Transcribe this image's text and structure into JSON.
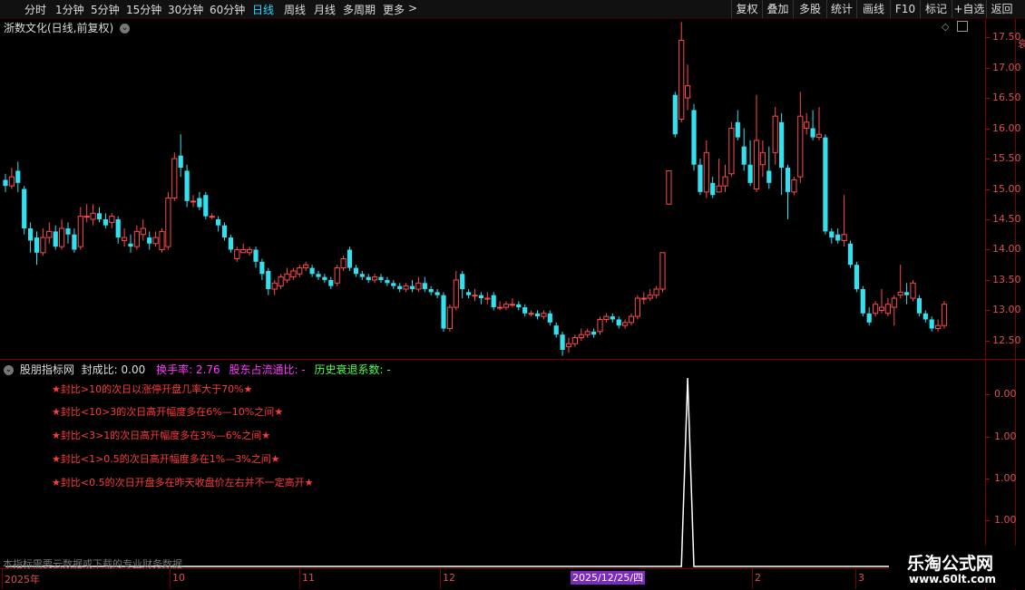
{
  "toolbar": {
    "periods": [
      "分时",
      "1分钟",
      "5分钟",
      "15分钟",
      "30分钟",
      "60分钟",
      "日线",
      "周线",
      "月线",
      "多周期",
      "更多"
    ],
    "active_period": "日线",
    "more_chevron": ">",
    "buttons": [
      "复权",
      "叠加",
      "多股",
      "统计",
      "画线",
      "F10",
      "标记",
      "+自选",
      "返回"
    ]
  },
  "stock": {
    "title": "浙数文化(日线,前复权)"
  },
  "price_axis": {
    "labels": [
      "17.50",
      "17.00",
      "16.50",
      "16.00",
      "15.50",
      "15.00",
      "14.50",
      "14.00",
      "13.50",
      "13.00",
      "12.50"
    ]
  },
  "indicator": {
    "name": "股朋指标网",
    "seal_ratio": "封成比: 0.00",
    "turnover": "换手率: 2.76",
    "shareholder": "股东占流通比: -",
    "decline": "历史衰退系数: -",
    "notes": [
      "★封比>10的次日以涨停开盘几率大于70%★",
      "★封比<10>3的次日高开幅度多在6%—10%之间★",
      "★封比<3>1的次日高开幅度多在3%—6%之间★",
      "★封比<1>0.5的次日高开幅度多在1%—3%之间★",
      "★封比<0.5的次日开盘多在昨天收盘价左右并不一定高开★"
    ],
    "axis_labels": [
      "0.00",
      "1.00",
      "1.00",
      "1.00",
      "1.00"
    ],
    "footnote": "本指标需要云数据或下载的专业财务数据"
  },
  "date_axis": {
    "labels": [
      "2025年",
      "10",
      "11",
      "12",
      "2",
      "3"
    ],
    "highlight": "2025/12/25/四"
  },
  "watermark": {
    "line1": "乐淘公式网",
    "line2": "www.60lt.com"
  },
  "colors": {
    "up": "#ff4a4a",
    "down": "#33e0f0",
    "active": "#2bd7ff",
    "axis": "#7a0000"
  },
  "chart_data": {
    "type": "candlestick",
    "ylim": [
      12.2,
      17.8
    ],
    "candles": [
      {
        "o": 15.15,
        "c": 15.05,
        "h": 15.25,
        "l": 14.95
      },
      {
        "o": 15.05,
        "c": 15.2,
        "h": 15.35,
        "l": 15.0
      },
      {
        "o": 15.3,
        "c": 15.1,
        "h": 15.45,
        "l": 14.95
      },
      {
        "o": 15.0,
        "c": 14.35,
        "h": 15.05,
        "l": 14.25
      },
      {
        "o": 14.35,
        "c": 14.15,
        "h": 14.45,
        "l": 13.95
      },
      {
        "o": 14.2,
        "c": 13.95,
        "h": 14.3,
        "l": 13.75
      },
      {
        "o": 13.95,
        "c": 14.2,
        "h": 14.35,
        "l": 13.9
      },
      {
        "o": 14.2,
        "c": 14.3,
        "h": 14.45,
        "l": 14.1
      },
      {
        "o": 14.3,
        "c": 14.05,
        "h": 14.4,
        "l": 14.0
      },
      {
        "o": 14.05,
        "c": 14.35,
        "h": 14.5,
        "l": 14.0
      },
      {
        "o": 14.35,
        "c": 14.25,
        "h": 14.45,
        "l": 14.1
      },
      {
        "o": 14.25,
        "c": 14.0,
        "h": 14.35,
        "l": 13.95
      },
      {
        "o": 14.05,
        "c": 14.55,
        "h": 14.7,
        "l": 14.0
      },
      {
        "o": 14.55,
        "c": 14.55,
        "h": 14.75,
        "l": 14.45
      },
      {
        "o": 14.5,
        "c": 14.6,
        "h": 14.75,
        "l": 14.4
      },
      {
        "o": 14.6,
        "c": 14.5,
        "h": 14.7,
        "l": 14.45
      },
      {
        "o": 14.5,
        "c": 14.4,
        "h": 14.6,
        "l": 14.35
      },
      {
        "o": 14.45,
        "c": 14.55,
        "h": 14.6,
        "l": 14.35
      },
      {
        "o": 14.5,
        "c": 14.2,
        "h": 14.55,
        "l": 14.1
      },
      {
        "o": 14.15,
        "c": 14.2,
        "h": 14.35,
        "l": 14.05
      },
      {
        "o": 14.1,
        "c": 14.05,
        "h": 14.25,
        "l": 13.95
      },
      {
        "o": 14.05,
        "c": 14.3,
        "h": 14.4,
        "l": 14.0
      },
      {
        "o": 14.25,
        "c": 14.35,
        "h": 14.5,
        "l": 14.15
      },
      {
        "o": 14.2,
        "c": 14.1,
        "h": 14.3,
        "l": 14.0
      },
      {
        "o": 14.1,
        "c": 14.2,
        "h": 14.3,
        "l": 14.05
      },
      {
        "o": 14.0,
        "c": 14.3,
        "h": 14.35,
        "l": 13.95
      },
      {
        "o": 14.05,
        "c": 14.85,
        "h": 14.95,
        "l": 14.0
      },
      {
        "o": 14.85,
        "c": 15.5,
        "h": 15.6,
        "l": 14.8
      },
      {
        "o": 15.55,
        "c": 15.35,
        "h": 15.9,
        "l": 15.2
      },
      {
        "o": 15.3,
        "c": 14.8,
        "h": 15.4,
        "l": 14.7
      },
      {
        "o": 14.8,
        "c": 14.8,
        "h": 14.9,
        "l": 14.7
      },
      {
        "o": 14.85,
        "c": 14.7,
        "h": 14.95,
        "l": 14.65
      },
      {
        "o": 14.9,
        "c": 14.55,
        "h": 14.95,
        "l": 14.5
      },
      {
        "o": 14.55,
        "c": 14.55,
        "h": 14.6,
        "l": 14.5
      },
      {
        "o": 14.5,
        "c": 14.4,
        "h": 14.55,
        "l": 14.3
      },
      {
        "o": 14.4,
        "c": 14.2,
        "h": 14.45,
        "l": 14.15
      },
      {
        "o": 14.2,
        "c": 14.0,
        "h": 14.25,
        "l": 13.95
      },
      {
        "o": 13.85,
        "c": 14.0,
        "h": 14.05,
        "l": 13.8
      },
      {
        "o": 13.95,
        "c": 14.0,
        "h": 14.1,
        "l": 13.95
      },
      {
        "o": 13.95,
        "c": 14.0,
        "h": 14.05,
        "l": 13.9
      },
      {
        "o": 14.0,
        "c": 13.8,
        "h": 14.05,
        "l": 13.7
      },
      {
        "o": 13.8,
        "c": 13.6,
        "h": 13.85,
        "l": 13.5
      },
      {
        "o": 13.65,
        "c": 13.35,
        "h": 13.7,
        "l": 13.25
      },
      {
        "o": 13.35,
        "c": 13.45,
        "h": 13.5,
        "l": 13.25
      },
      {
        "o": 13.4,
        "c": 13.55,
        "h": 13.6,
        "l": 13.35
      },
      {
        "o": 13.5,
        "c": 13.6,
        "h": 13.7,
        "l": 13.45
      },
      {
        "o": 13.55,
        "c": 13.65,
        "h": 13.7,
        "l": 13.5
      },
      {
        "o": 13.6,
        "c": 13.7,
        "h": 13.75,
        "l": 13.55
      },
      {
        "o": 13.7,
        "c": 13.75,
        "h": 13.8,
        "l": 13.65
      },
      {
        "o": 13.7,
        "c": 13.6,
        "h": 13.75,
        "l": 13.55
      },
      {
        "o": 13.6,
        "c": 13.55,
        "h": 13.65,
        "l": 13.5
      },
      {
        "o": 13.55,
        "c": 13.5,
        "h": 13.6,
        "l": 13.45
      },
      {
        "o": 13.5,
        "c": 13.4,
        "h": 13.55,
        "l": 13.35
      },
      {
        "o": 13.45,
        "c": 13.7,
        "h": 13.75,
        "l": 13.4
      },
      {
        "o": 13.7,
        "c": 13.85,
        "h": 13.9,
        "l": 13.65
      },
      {
        "o": 14.0,
        "c": 13.7,
        "h": 14.05,
        "l": 13.65
      },
      {
        "o": 13.7,
        "c": 13.6,
        "h": 13.75,
        "l": 13.55
      },
      {
        "o": 13.6,
        "c": 13.55,
        "h": 13.65,
        "l": 13.5
      },
      {
        "o": 13.55,
        "c": 13.5,
        "h": 13.6,
        "l": 13.45
      },
      {
        "o": 13.5,
        "c": 13.55,
        "h": 13.6,
        "l": 13.45
      },
      {
        "o": 13.55,
        "c": 13.5,
        "h": 13.6,
        "l": 13.45
      },
      {
        "o": 13.5,
        "c": 13.45,
        "h": 13.55,
        "l": 13.4
      },
      {
        "o": 13.45,
        "c": 13.4,
        "h": 13.5,
        "l": 13.35
      },
      {
        "o": 13.4,
        "c": 13.35,
        "h": 13.45,
        "l": 13.3
      },
      {
        "o": 13.35,
        "c": 13.4,
        "h": 13.45,
        "l": 13.3
      },
      {
        "o": 13.4,
        "c": 13.35,
        "h": 13.5,
        "l": 13.3
      },
      {
        "o": 13.35,
        "c": 13.45,
        "h": 13.55,
        "l": 13.3
      },
      {
        "o": 13.45,
        "c": 13.35,
        "h": 13.55,
        "l": 13.3
      },
      {
        "o": 13.35,
        "c": 13.3,
        "h": 13.4,
        "l": 13.25
      },
      {
        "o": 13.3,
        "c": 13.25,
        "h": 13.35,
        "l": 13.2
      },
      {
        "o": 13.25,
        "c": 12.7,
        "h": 13.3,
        "l": 12.65
      },
      {
        "o": 12.7,
        "c": 13.05,
        "h": 13.1,
        "l": 12.65
      },
      {
        "o": 13.05,
        "c": 13.5,
        "h": 13.65,
        "l": 13.0
      },
      {
        "o": 13.6,
        "c": 13.35,
        "h": 13.65,
        "l": 13.2
      },
      {
        "o": 13.3,
        "c": 13.25,
        "h": 13.35,
        "l": 13.2
      },
      {
        "o": 13.25,
        "c": 13.25,
        "h": 13.35,
        "l": 13.15
      },
      {
        "o": 13.25,
        "c": 13.2,
        "h": 13.3,
        "l": 13.1
      },
      {
        "o": 13.2,
        "c": 13.2,
        "h": 13.3,
        "l": 13.1
      },
      {
        "o": 13.25,
        "c": 13.05,
        "h": 13.3,
        "l": 13.0
      },
      {
        "o": 13.05,
        "c": 13.05,
        "h": 13.15,
        "l": 13.0
      },
      {
        "o": 13.05,
        "c": 13.1,
        "h": 13.15,
        "l": 13.0
      },
      {
        "o": 13.1,
        "c": 13.1,
        "h": 13.2,
        "l": 13.05
      },
      {
        "o": 13.1,
        "c": 13.05,
        "h": 13.15,
        "l": 13.0
      },
      {
        "o": 13.05,
        "c": 12.95,
        "h": 13.1,
        "l": 12.9
      },
      {
        "o": 12.95,
        "c": 12.95,
        "h": 13.0,
        "l": 12.9
      },
      {
        "o": 12.95,
        "c": 12.9,
        "h": 13.0,
        "l": 12.85
      },
      {
        "o": 12.9,
        "c": 12.95,
        "h": 13.0,
        "l": 12.85
      },
      {
        "o": 12.95,
        "c": 12.8,
        "h": 13.0,
        "l": 12.75
      },
      {
        "o": 12.75,
        "c": 12.6,
        "h": 12.8,
        "l": 12.55
      },
      {
        "o": 12.6,
        "c": 12.35,
        "h": 12.65,
        "l": 12.25
      },
      {
        "o": 12.4,
        "c": 12.45,
        "h": 12.55,
        "l": 12.3
      },
      {
        "o": 12.45,
        "c": 12.55,
        "h": 12.6,
        "l": 12.4
      },
      {
        "o": 12.55,
        "c": 12.6,
        "h": 12.7,
        "l": 12.5
      },
      {
        "o": 12.6,
        "c": 12.65,
        "h": 12.7,
        "l": 12.55
      },
      {
        "o": 12.65,
        "c": 12.6,
        "h": 12.7,
        "l": 12.55
      },
      {
        "o": 12.65,
        "c": 12.85,
        "h": 12.9,
        "l": 12.6
      },
      {
        "o": 12.85,
        "c": 12.9,
        "h": 12.95,
        "l": 12.8
      },
      {
        "o": 12.9,
        "c": 12.85,
        "h": 12.95,
        "l": 12.8
      },
      {
        "o": 12.85,
        "c": 12.75,
        "h": 12.9,
        "l": 12.7
      },
      {
        "o": 12.75,
        "c": 12.8,
        "h": 12.85,
        "l": 12.7
      },
      {
        "o": 12.8,
        "c": 12.9,
        "h": 12.95,
        "l": 12.75
      },
      {
        "o": 12.9,
        "c": 13.2,
        "h": 13.25,
        "l": 12.85
      },
      {
        "o": 13.2,
        "c": 13.2,
        "h": 13.3,
        "l": 13.1
      },
      {
        "o": 13.2,
        "c": 13.25,
        "h": 13.35,
        "l": 13.15
      },
      {
        "o": 13.25,
        "c": 13.35,
        "h": 13.4,
        "l": 13.2
      },
      {
        "o": 13.35,
        "c": 13.95,
        "h": 13.95,
        "l": 13.3
      },
      {
        "o": 14.75,
        "c": 15.3,
        "h": 15.3,
        "l": 14.75
      },
      {
        "o": 16.55,
        "c": 15.9,
        "h": 16.6,
        "l": 15.85
      },
      {
        "o": 16.15,
        "c": 17.45,
        "h": 17.75,
        "l": 16.1
      },
      {
        "o": 16.5,
        "c": 16.7,
        "h": 17.05,
        "l": 16.3
      },
      {
        "o": 16.3,
        "c": 15.4,
        "h": 16.4,
        "l": 15.3
      },
      {
        "o": 15.4,
        "c": 14.95,
        "h": 15.5,
        "l": 14.9
      },
      {
        "o": 14.95,
        "c": 15.6,
        "h": 15.8,
        "l": 14.85
      },
      {
        "o": 15.1,
        "c": 14.9,
        "h": 15.2,
        "l": 14.85
      },
      {
        "o": 14.95,
        "c": 15.05,
        "h": 15.5,
        "l": 14.95
      },
      {
        "o": 15.05,
        "c": 15.2,
        "h": 15.4,
        "l": 14.95
      },
      {
        "o": 15.25,
        "c": 16.0,
        "h": 16.1,
        "l": 15.2
      },
      {
        "o": 16.1,
        "c": 15.85,
        "h": 16.3,
        "l": 15.8
      },
      {
        "o": 15.7,
        "c": 15.4,
        "h": 16.0,
        "l": 15.3
      },
      {
        "o": 15.4,
        "c": 15.1,
        "h": 15.8,
        "l": 15.05
      },
      {
        "o": 15.0,
        "c": 15.8,
        "h": 16.55,
        "l": 14.95
      },
      {
        "o": 15.4,
        "c": 15.6,
        "h": 15.8,
        "l": 15.2
      },
      {
        "o": 15.3,
        "c": 15.1,
        "h": 15.7,
        "l": 15.0
      },
      {
        "o": 15.6,
        "c": 16.2,
        "h": 16.35,
        "l": 15.4
      },
      {
        "o": 16.1,
        "c": 15.35,
        "h": 16.25,
        "l": 14.9
      },
      {
        "o": 15.35,
        "c": 14.95,
        "h": 15.4,
        "l": 14.5
      },
      {
        "o": 14.95,
        "c": 15.15,
        "h": 15.2,
        "l": 14.9
      },
      {
        "o": 15.2,
        "c": 16.2,
        "h": 16.6,
        "l": 15.1
      },
      {
        "o": 16.0,
        "c": 16.1,
        "h": 16.25,
        "l": 15.9
      },
      {
        "o": 16.0,
        "c": 15.85,
        "h": 16.3,
        "l": 15.8
      },
      {
        "o": 15.85,
        "c": 15.9,
        "h": 16.35,
        "l": 15.8
      },
      {
        "o": 15.85,
        "c": 14.3,
        "h": 15.9,
        "l": 14.25
      },
      {
        "o": 14.3,
        "c": 14.2,
        "h": 14.35,
        "l": 14.1
      },
      {
        "o": 14.25,
        "c": 14.15,
        "h": 14.35,
        "l": 14.1
      },
      {
        "o": 14.15,
        "c": 14.25,
        "h": 14.9,
        "l": 14.05
      },
      {
        "o": 14.1,
        "c": 13.75,
        "h": 14.15,
        "l": 13.7
      },
      {
        "o": 13.75,
        "c": 13.35,
        "h": 13.8,
        "l": 13.3
      },
      {
        "o": 13.35,
        "c": 12.95,
        "h": 13.4,
        "l": 12.9
      },
      {
        "o": 12.95,
        "c": 12.8,
        "h": 13.05,
        "l": 12.75
      },
      {
        "o": 12.95,
        "c": 13.1,
        "h": 13.15,
        "l": 12.9
      },
      {
        "o": 13.0,
        "c": 13.05,
        "h": 13.35,
        "l": 12.95
      },
      {
        "o": 12.95,
        "c": 13.1,
        "h": 13.2,
        "l": 12.9
      },
      {
        "o": 13.05,
        "c": 13.2,
        "h": 13.25,
        "l": 12.75
      },
      {
        "o": 13.25,
        "c": 13.3,
        "h": 13.75,
        "l": 13.2
      },
      {
        "o": 13.3,
        "c": 13.25,
        "h": 13.45,
        "l": 13.1
      },
      {
        "o": 13.2,
        "c": 13.45,
        "h": 13.5,
        "l": 13.15
      },
      {
        "o": 13.2,
        "c": 12.95,
        "h": 13.25,
        "l": 12.9
      },
      {
        "o": 12.95,
        "c": 12.85,
        "h": 13.0,
        "l": 12.8
      },
      {
        "o": 12.85,
        "c": 12.7,
        "h": 12.9,
        "l": 12.65
      },
      {
        "o": 12.7,
        "c": 12.75,
        "h": 12.85,
        "l": 12.65
      },
      {
        "o": 12.75,
        "c": 13.1,
        "h": 13.15,
        "l": 12.7
      }
    ],
    "indicator_series": {
      "name": "封成比",
      "spike_index": 109,
      "spike_value": 1.0,
      "baseline": 0
    }
  }
}
